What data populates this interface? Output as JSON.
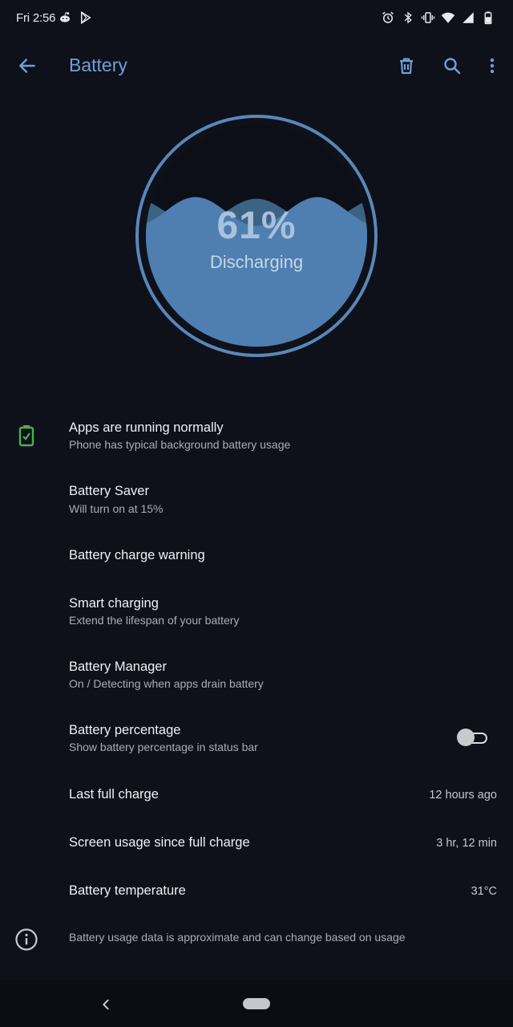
{
  "status_bar": {
    "time": "Fri 2:56",
    "left_icons": [
      "reddit-icon",
      "play-store-icon"
    ],
    "right_icons": [
      "alarm-icon",
      "bluetooth-icon",
      "vibrate-icon",
      "wifi-icon",
      "signal-icon",
      "battery-icon"
    ]
  },
  "app_bar": {
    "title": "Battery",
    "actions": [
      "delete-icon",
      "search-icon",
      "more-vert-icon"
    ]
  },
  "gauge": {
    "percent_text": "61%",
    "level": 0.61,
    "status": "Discharging"
  },
  "items": [
    {
      "title": "Apps are running normally",
      "subtitle": "Phone has typical background battery usage",
      "icon": "battery-check-icon"
    },
    {
      "title": "Battery Saver",
      "subtitle": "Will turn on at 15%"
    },
    {
      "title": "Battery charge warning"
    },
    {
      "title": "Smart charging",
      "subtitle": "Extend the lifespan of your battery"
    },
    {
      "title": "Battery Manager",
      "subtitle": "On / Detecting when apps drain battery"
    },
    {
      "title": "Battery percentage",
      "subtitle": "Show battery percentage in status bar",
      "toggle": false
    },
    {
      "title": "Last full charge",
      "value": "12 hours ago"
    },
    {
      "title": "Screen usage since full charge",
      "value": "3 hr, 12 min"
    },
    {
      "title": "Battery temperature",
      "value": "31°C"
    }
  ],
  "footer": {
    "icon": "info-icon",
    "text": "Battery usage data is approximate and can change based on usage"
  },
  "colors": {
    "background": "#0e111a",
    "accent": "#6fa0d8",
    "gauge_fill": "#4e7fb0",
    "ok_green": "#4caf50"
  }
}
